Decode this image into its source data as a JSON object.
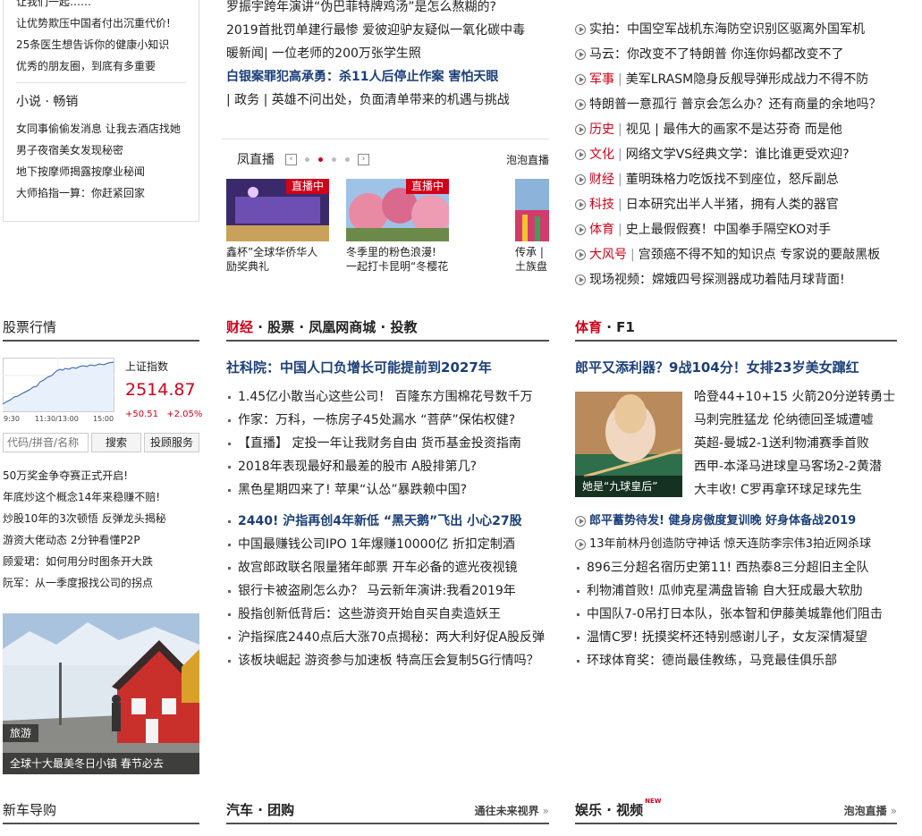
{
  "left": {
    "top_links": [
      "让我们一起……",
      "让优势欺压中国者付出沉重代价!",
      "25条医生想告诉你的健康小知识",
      "优秀的朋友圈，到底有多重要"
    ],
    "novel_title": "小说 · 畅销",
    "novels": [
      "女同事偷偷发消息 让我去酒店找她",
      "男子夜宿美女发现秘密",
      "地下按摩师揭露按摩业秘闻",
      "大师掐指一算：你赶紧回家"
    ]
  },
  "stock": {
    "title": "股票行情",
    "name": "上证指数",
    "value": "2514.87",
    "change": "+50.51",
    "change_pct": "+2.05%",
    "time_labels": [
      "9:30",
      "11:30/13:00",
      "15:00"
    ],
    "search_placeholder": "代码/拼音/名称",
    "search_btn": "搜索",
    "invest_btn": "投顾服务",
    "links": [
      "50万奖金争夺赛正式开启!",
      "年底炒这个概念14年来稳赚不赔!",
      "炒股10年的3次顿悟  反弹龙头揭秘",
      "游资大佬动态  2分钟看懂P2P",
      "顾爱珺：如何用分时图条开大跌",
      "阮军：从一季度报找公司的拐点"
    ]
  },
  "travel": {
    "tag": "旅游",
    "caption": "全球十大最美冬日小镇 春节必去"
  },
  "newcar": {
    "title": "新车导购"
  },
  "mid_top": {
    "items": [
      {
        "text": "罗振宇跨年演讲“伪巴菲特牌鸡汤”是怎么熬糊的?",
        "bold": false
      },
      {
        "text": "2019首批罚单建行最惨 爱彼迎驴友疑似一氧化碳中毒",
        "bold": false
      },
      {
        "text": "暖新闻| 一位老师的200万张学生照",
        "bold": false
      },
      {
        "text": "白银案罪犯高承勇：杀11人后停止作案 害怕天眼",
        "bold": true
      },
      {
        "text": "| 政务 | 英雄不问出处，负面清单带来的机遇与挑战",
        "bold": false
      }
    ]
  },
  "feng": {
    "title": "凤直播",
    "more": "泡泡直播",
    "cards": [
      {
        "badge": "直播中",
        "caption": "鑫杯”全球华侨华人 励奖典礼"
      },
      {
        "badge": "直播中",
        "caption": "冬季里的粉色浪漫! 一起打卡昆明“冬樱花大道”"
      },
      {
        "badge": "",
        "caption": "传承 | 土族盘"
      }
    ]
  },
  "finance": {
    "title_a": "财经",
    "title_b": " · 股票 · 凤凰网商城 · 投教",
    "headline1": "社科院：中国人口负增长可能提前到2027年",
    "list1": [
      "1.45亿小散当心这些公司！ 百隆东方围棉花号数千万",
      "作家：万科，一栋房子45处漏水 “菩萨”保佑权健?",
      "【直播】 定投一年让我财务自由 货币基金投资指南",
      "2018年表现最好和最差的股市 A股排第几?",
      "黑色星期四来了! 苹果“认怂”暴跌赖中国?"
    ],
    "headline2": "2440! 沪指再创4年新低 “黑天鹅”飞出 小心27股",
    "list2": [
      "中国最赚钱公司IPO 1年爆赚10000亿 折扣定制酒",
      "故宫郎政联名限量猪年邮票 开车必备的遮光夜视镜",
      "银行卡被盗刷怎么办？ 马云新年演讲:我看2019年",
      "股指创新低背后：这些游资开始自买自卖造妖王",
      "沪指探底2440点后大涨70点揭秘：两大利好促A股反弹",
      "该板块崛起 游资参与加速板 特高压会复制5G行情吗？"
    ]
  },
  "auto": {
    "title": "汽车 · 团购",
    "more": "通往未来视界"
  },
  "right_top": {
    "items": [
      {
        "cat": "",
        "text": "实拍：中国空军战机东海防空识别区驱离外国军机"
      },
      {
        "cat": "",
        "text": "马云：你改变不了特朗普 你连你妈都改变不了"
      },
      {
        "cat": "军事",
        "text": "美军LRASM隐身反舰导弹形成战力不得不防"
      },
      {
        "cat": "",
        "text": "特朗普一意孤行 普京会怎么办？还有商量的余地吗？"
      },
      {
        "cat": "历史",
        "text": "视见 | 最伟大的画家不是达芬奇 而是他"
      },
      {
        "cat": "文化",
        "text": "网络文学VS经典文学：谁比谁更受欢迎?"
      },
      {
        "cat": "财经",
        "text": "董明珠格力吃饭找不到座位，怒斥副总"
      },
      {
        "cat": "科技",
        "text": "日本研究出半人半猪，拥有人类的器官"
      },
      {
        "cat": "体育",
        "text": "史上最假假赛！中国拳手隔空KO对手"
      },
      {
        "cat": "大风号",
        "text": "宫颈癌不得不知的知识点 专家说的要敲黑板"
      },
      {
        "cat": "",
        "text": "现场视频：嫦娥四号探测器成功着陆月球背面!"
      }
    ]
  },
  "sports": {
    "title_a": "体育",
    "title_b": " · F1",
    "headline": "郎平又添利器？9战104分！女排23岁美女蹿红",
    "img_caption": "她是“九球皇后”",
    "side_list": [
      "哈登44+10+15 火箭20分逆转勇士",
      "马刺完胜猛龙 伦纳德回圣城遭嘘",
      "英超-曼城2-1送利物浦赛季首败",
      "西甲-本泽马进球皇马客场2-2黄潜",
      "大丰收! C罗再拿环球足球先生"
    ],
    "bold_line": "郎平蓄势待发! 健身房傲度复训晚 好身体备战2019",
    "list": [
      "13年前林丹创造防守神话 惊天连防李宗伟3拍近网杀球",
      "896三分超名宿历史第11! 西热泰8三分超旧主全队",
      "利物浦首败! 瓜帅克星满盘皆输 自大狂成最大软肋",
      "中国队7-0吊打日本队，张本智和伊藤美城靠他们阻击",
      "温情C罗! 抚摸奖杯还特别感谢儿子，女友深情凝望",
      "环球体育奖：德尚最佳教练，马竞最佳俱乐部"
    ]
  },
  "ent": {
    "title": "娱乐 · 视频",
    "new_badge": "NEW",
    "more": "泡泡直播"
  },
  "colors": {
    "accent": "#d0021b",
    "navy": "#1b3f7a",
    "rule": "#505050"
  }
}
